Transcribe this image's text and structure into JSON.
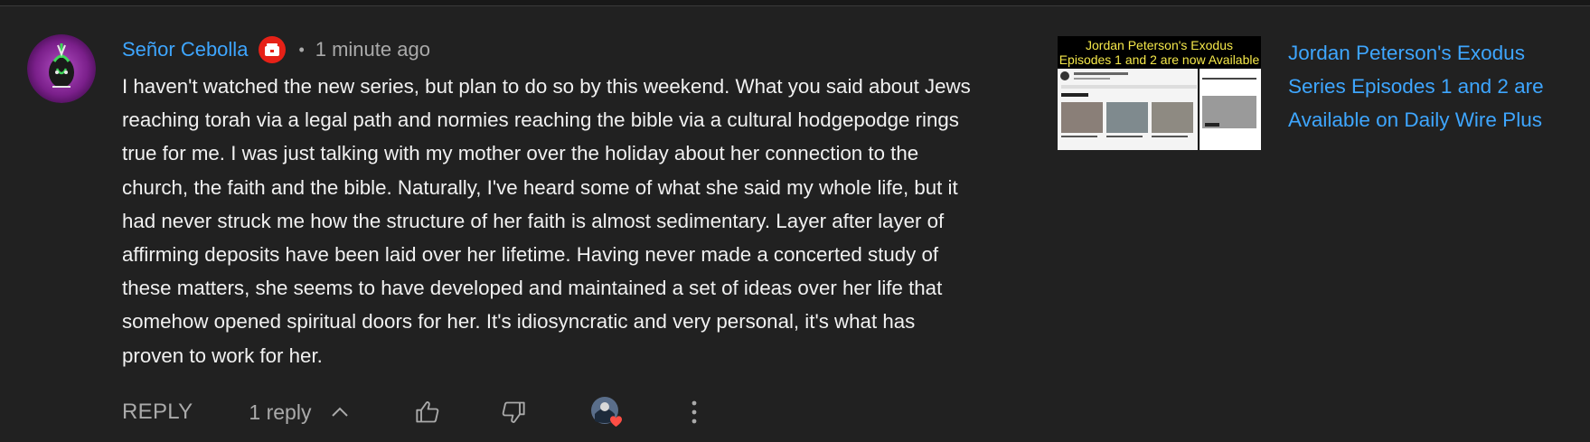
{
  "comment": {
    "author": "Señor Cebolla",
    "separator": "•",
    "timestamp": "1 minute ago",
    "body": "I haven't watched the new series, but plan to do so by this weekend. What you said about Jews\nreaching torah via a legal path and normies reaching the bible via a cultural hodgepodge rings\ntrue for me. I was just talking with my mother over the holiday about her connection to the\nchurch, the faith and the bible. Naturally, I've heard some of what she said my whole life, but it\nhad never struck me how the structure of her faith is almost sedimentary. Layer after layer of\naffirming deposits have been laid over her lifetime. Having never made a concerted study of\nthese matters, she seems to have developed and maintained a set of ideas over her life that\nsomehow opened spiritual doors for her. It's idiosyncratic and very personal, it's what has\nproven to work for her."
  },
  "actions": {
    "reply_label": "REPLY",
    "replies_label": "1 reply"
  },
  "icons": {
    "member_badge": "youtube-member-badge-icon",
    "like": "thumbs-up-icon",
    "dislike": "thumbs-down-icon",
    "heart": "creator-heart-icon",
    "more": "more-vert-icon",
    "chevron": "chevron-up-icon"
  },
  "linked_video": {
    "thumbnail_banner_line1": "Jordan Peterson's Exodus",
    "thumbnail_banner_line2": "Episodes 1 and 2 are now Available",
    "title": "Jordan Peterson's Exodus Series Episodes 1 and 2 are Available on Daily Wire Plus"
  },
  "colors": {
    "background": "#212121",
    "link": "#3ea6ff",
    "secondary_text": "#aaaaaa",
    "badge_red": "#e62117",
    "heart_red": "#ff4e45"
  }
}
